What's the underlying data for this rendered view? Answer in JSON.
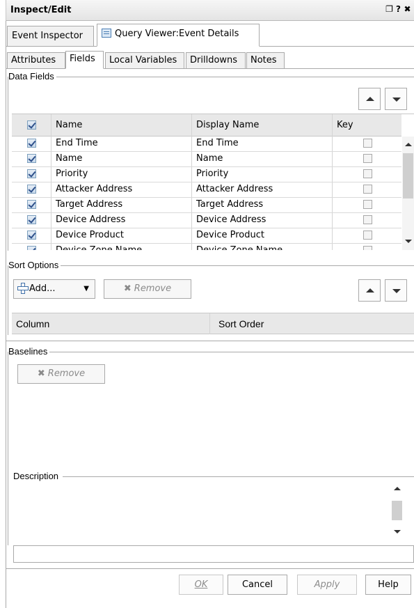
{
  "window": {
    "title": "Inspect/Edit",
    "restore_glyph": "❐",
    "help_glyph": "?",
    "close_glyph": "✖"
  },
  "outer_tabs": [
    {
      "label": "Event Inspector"
    },
    {
      "label": "Query Viewer:Event Details",
      "icon": "query-viewer-icon"
    }
  ],
  "sub_tabs": [
    {
      "label": "Attributes"
    },
    {
      "label": "Fields",
      "active": true
    },
    {
      "label": "Local Variables"
    },
    {
      "label": "Drilldowns"
    },
    {
      "label": "Notes"
    }
  ],
  "data_fields": {
    "label": "Data Fields",
    "columns": {
      "name": "Name",
      "display_name": "Display Name",
      "key": "Key"
    },
    "rows": [
      {
        "name": "End Time",
        "display_name": "End Time",
        "checked": true,
        "key": false
      },
      {
        "name": "Name",
        "display_name": "Name",
        "checked": true,
        "key": false
      },
      {
        "name": "Priority",
        "display_name": "Priority",
        "checked": true,
        "key": false
      },
      {
        "name": "Attacker Address",
        "display_name": "Attacker Address",
        "checked": true,
        "key": false
      },
      {
        "name": "Target Address",
        "display_name": "Target Address",
        "checked": true,
        "key": false
      },
      {
        "name": "Device Address",
        "display_name": "Device Address",
        "checked": true,
        "key": false
      },
      {
        "name": "Device Product",
        "display_name": "Device Product",
        "checked": true,
        "key": false
      },
      {
        "name": "Device Zone Name",
        "display_name": "Device Zone Name",
        "checked": true,
        "key": false
      }
    ]
  },
  "sort_options": {
    "label": "Sort Options",
    "add_label": "Add...",
    "remove_label": "Remove",
    "columns": {
      "column": "Column",
      "sort_order": "Sort Order"
    }
  },
  "baselines": {
    "label": "Baselines",
    "remove_label": "Remove"
  },
  "description": {
    "label": "Description",
    "value": ""
  },
  "footer": {
    "ok_label": "OK",
    "cancel_label": "Cancel",
    "apply_label": "Apply",
    "help_label": "Help"
  }
}
